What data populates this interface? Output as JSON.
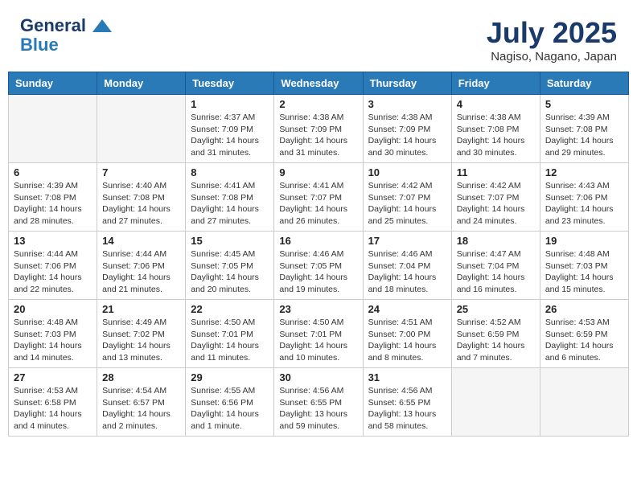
{
  "header": {
    "logo_line1": "General",
    "logo_line2": "Blue",
    "month": "July 2025",
    "location": "Nagiso, Nagano, Japan"
  },
  "weekdays": [
    "Sunday",
    "Monday",
    "Tuesday",
    "Wednesday",
    "Thursday",
    "Friday",
    "Saturday"
  ],
  "weeks": [
    [
      {
        "day": "",
        "info": ""
      },
      {
        "day": "",
        "info": ""
      },
      {
        "day": "1",
        "info": "Sunrise: 4:37 AM\nSunset: 7:09 PM\nDaylight: 14 hours and 31 minutes."
      },
      {
        "day": "2",
        "info": "Sunrise: 4:38 AM\nSunset: 7:09 PM\nDaylight: 14 hours and 31 minutes."
      },
      {
        "day": "3",
        "info": "Sunrise: 4:38 AM\nSunset: 7:09 PM\nDaylight: 14 hours and 30 minutes."
      },
      {
        "day": "4",
        "info": "Sunrise: 4:38 AM\nSunset: 7:08 PM\nDaylight: 14 hours and 30 minutes."
      },
      {
        "day": "5",
        "info": "Sunrise: 4:39 AM\nSunset: 7:08 PM\nDaylight: 14 hours and 29 minutes."
      }
    ],
    [
      {
        "day": "6",
        "info": "Sunrise: 4:39 AM\nSunset: 7:08 PM\nDaylight: 14 hours and 28 minutes."
      },
      {
        "day": "7",
        "info": "Sunrise: 4:40 AM\nSunset: 7:08 PM\nDaylight: 14 hours and 27 minutes."
      },
      {
        "day": "8",
        "info": "Sunrise: 4:41 AM\nSunset: 7:08 PM\nDaylight: 14 hours and 27 minutes."
      },
      {
        "day": "9",
        "info": "Sunrise: 4:41 AM\nSunset: 7:07 PM\nDaylight: 14 hours and 26 minutes."
      },
      {
        "day": "10",
        "info": "Sunrise: 4:42 AM\nSunset: 7:07 PM\nDaylight: 14 hours and 25 minutes."
      },
      {
        "day": "11",
        "info": "Sunrise: 4:42 AM\nSunset: 7:07 PM\nDaylight: 14 hours and 24 minutes."
      },
      {
        "day": "12",
        "info": "Sunrise: 4:43 AM\nSunset: 7:06 PM\nDaylight: 14 hours and 23 minutes."
      }
    ],
    [
      {
        "day": "13",
        "info": "Sunrise: 4:44 AM\nSunset: 7:06 PM\nDaylight: 14 hours and 22 minutes."
      },
      {
        "day": "14",
        "info": "Sunrise: 4:44 AM\nSunset: 7:06 PM\nDaylight: 14 hours and 21 minutes."
      },
      {
        "day": "15",
        "info": "Sunrise: 4:45 AM\nSunset: 7:05 PM\nDaylight: 14 hours and 20 minutes."
      },
      {
        "day": "16",
        "info": "Sunrise: 4:46 AM\nSunset: 7:05 PM\nDaylight: 14 hours and 19 minutes."
      },
      {
        "day": "17",
        "info": "Sunrise: 4:46 AM\nSunset: 7:04 PM\nDaylight: 14 hours and 18 minutes."
      },
      {
        "day": "18",
        "info": "Sunrise: 4:47 AM\nSunset: 7:04 PM\nDaylight: 14 hours and 16 minutes."
      },
      {
        "day": "19",
        "info": "Sunrise: 4:48 AM\nSunset: 7:03 PM\nDaylight: 14 hours and 15 minutes."
      }
    ],
    [
      {
        "day": "20",
        "info": "Sunrise: 4:48 AM\nSunset: 7:03 PM\nDaylight: 14 hours and 14 minutes."
      },
      {
        "day": "21",
        "info": "Sunrise: 4:49 AM\nSunset: 7:02 PM\nDaylight: 14 hours and 13 minutes."
      },
      {
        "day": "22",
        "info": "Sunrise: 4:50 AM\nSunset: 7:01 PM\nDaylight: 14 hours and 11 minutes."
      },
      {
        "day": "23",
        "info": "Sunrise: 4:50 AM\nSunset: 7:01 PM\nDaylight: 14 hours and 10 minutes."
      },
      {
        "day": "24",
        "info": "Sunrise: 4:51 AM\nSunset: 7:00 PM\nDaylight: 14 hours and 8 minutes."
      },
      {
        "day": "25",
        "info": "Sunrise: 4:52 AM\nSunset: 6:59 PM\nDaylight: 14 hours and 7 minutes."
      },
      {
        "day": "26",
        "info": "Sunrise: 4:53 AM\nSunset: 6:59 PM\nDaylight: 14 hours and 6 minutes."
      }
    ],
    [
      {
        "day": "27",
        "info": "Sunrise: 4:53 AM\nSunset: 6:58 PM\nDaylight: 14 hours and 4 minutes."
      },
      {
        "day": "28",
        "info": "Sunrise: 4:54 AM\nSunset: 6:57 PM\nDaylight: 14 hours and 2 minutes."
      },
      {
        "day": "29",
        "info": "Sunrise: 4:55 AM\nSunset: 6:56 PM\nDaylight: 14 hours and 1 minute."
      },
      {
        "day": "30",
        "info": "Sunrise: 4:56 AM\nSunset: 6:55 PM\nDaylight: 13 hours and 59 minutes."
      },
      {
        "day": "31",
        "info": "Sunrise: 4:56 AM\nSunset: 6:55 PM\nDaylight: 13 hours and 58 minutes."
      },
      {
        "day": "",
        "info": ""
      },
      {
        "day": "",
        "info": ""
      }
    ]
  ]
}
